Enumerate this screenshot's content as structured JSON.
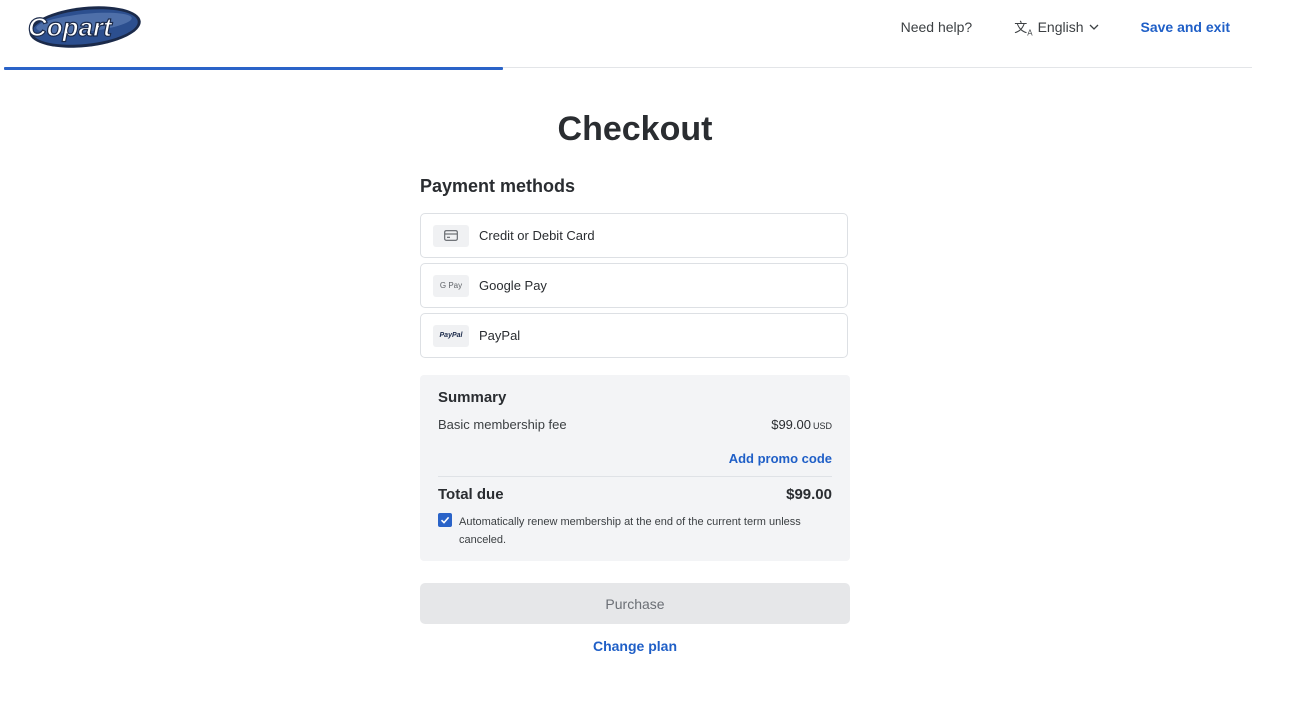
{
  "header": {
    "logo_text": "Copart",
    "help_label": "Need help?",
    "language_label": "English",
    "save_exit_label": "Save and exit",
    "progress_fraction": 0.4
  },
  "page": {
    "title": "Checkout",
    "payment_methods_title": "Payment methods"
  },
  "payment_methods": [
    {
      "icon": "credit-card-icon",
      "icon_text": "",
      "label": "Credit or Debit Card"
    },
    {
      "icon": "google-pay-icon",
      "icon_text": "G Pay",
      "label": "Google Pay"
    },
    {
      "icon": "paypal-icon",
      "icon_text": "PayPal",
      "label": "PayPal"
    }
  ],
  "summary": {
    "title": "Summary",
    "fee_label": "Basic membership fee",
    "fee_value": "$99.00",
    "fee_currency": "USD",
    "promo_label": "Add promo code",
    "total_label": "Total due",
    "total_value": "$99.00",
    "renew_checked": true,
    "renew_text": "Automatically renew membership at the end of the current term unless canceled."
  },
  "actions": {
    "purchase_label": "Purchase",
    "change_plan_label": "Change plan"
  },
  "colors": {
    "accent": "#1f5fc7",
    "progress": "#2a63c8",
    "summary_bg": "#f3f4f6",
    "button_disabled_bg": "#e6e7e9"
  }
}
